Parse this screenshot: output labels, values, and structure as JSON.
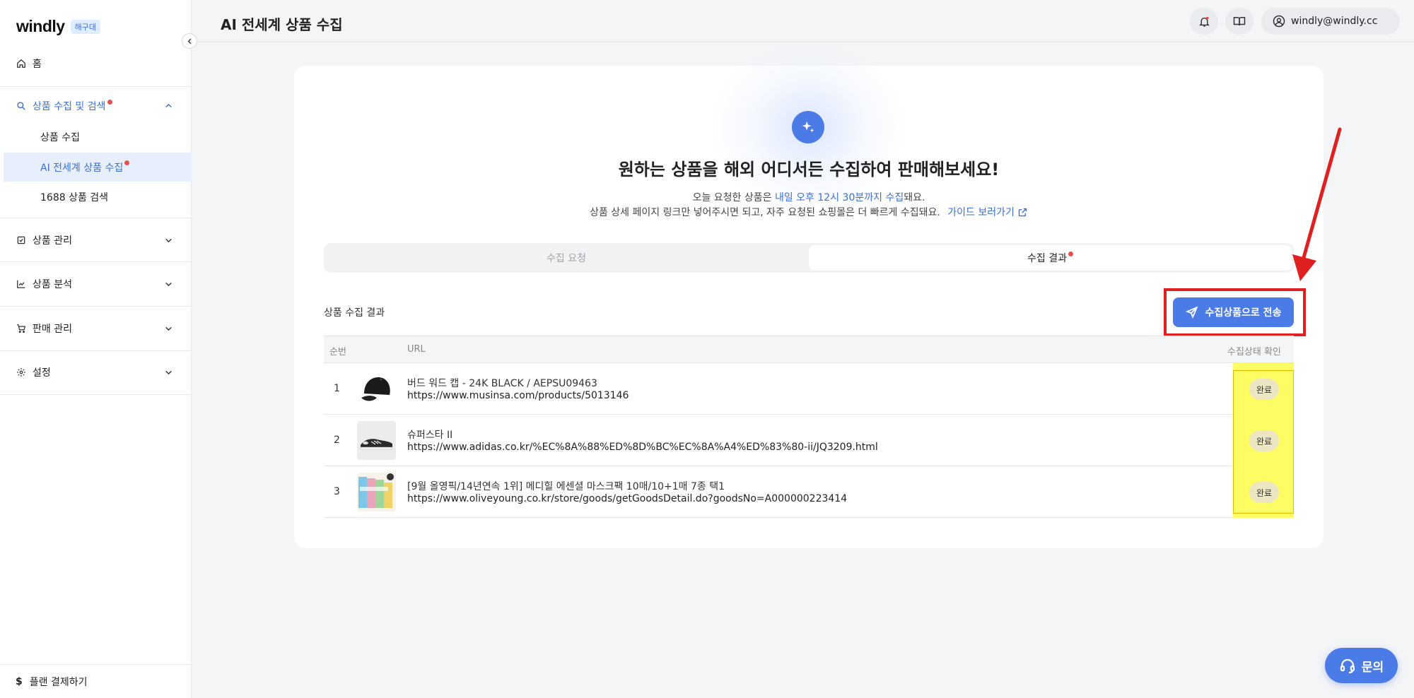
{
  "sidebar": {
    "brand": "windly",
    "brand_badge": "해구대",
    "home": "홈",
    "collect_search": "상품 수집 및 검색",
    "sub_items": [
      "상품 수집",
      "AI 전세계 상품 수집",
      "1688 상품 검색"
    ],
    "product_manage": "상품 관리",
    "product_analysis": "상품 분석",
    "sales_manage": "판매 관리",
    "settings": "설정",
    "plan": "플랜 결제하기"
  },
  "header": {
    "title": "AI 전세계 상품 수집",
    "user_email": "windly@windly.cc"
  },
  "main": {
    "headline": "원하는 상품을 해외 어디서든 수집하여 판매해보세요!",
    "info1_prefix": "오늘 요청한 상품은 ",
    "info1_highlight": "내일 오후 12시 30분까지 수집",
    "info1_suffix": "돼요.",
    "info2_text": "상품 상세 페이지 링크만 넣어주시면 되고, 자주 요청된 쇼핑몰은 더 빠르게 수집돼요.",
    "guide_link": "가이드 보러가기",
    "tabs": [
      "수집 요청",
      "수집 결과"
    ],
    "section_label": "상품 수집 결과",
    "send_button": "수집상품으로 전송",
    "table": {
      "headers": [
        "순번",
        "URL",
        "수집상태 확인"
      ],
      "rows": [
        {
          "idx": "1",
          "name": "버드 워드 캡 - 24K BLACK / AEPSU09463",
          "url": "https://www.musinsa.com/products/5013146",
          "status": "완료"
        },
        {
          "idx": "2",
          "name": "슈퍼스타 II",
          "url": "https://www.adidas.co.kr/%EC%8A%88%ED%8D%BC%EC%8A%A4%ED%83%80-ii/JQ3209.html",
          "status": "완료"
        },
        {
          "idx": "3",
          "name": "[9월 올영픽/14년연속 1위] 메디힐 에센셜 마스크팩 10매/10+1매 7종 택1",
          "url": "https://www.oliveyoung.co.kr/store/goods/getGoodsDetail.do?goodsNo=A000000223414",
          "status": "완료"
        }
      ]
    }
  },
  "chat_button": "문의",
  "colors": {
    "accent": "#4b7be6",
    "highlight_red": "#e02020",
    "highlight_yellow": "#fcfc63",
    "alert_dot": "#e85050"
  }
}
